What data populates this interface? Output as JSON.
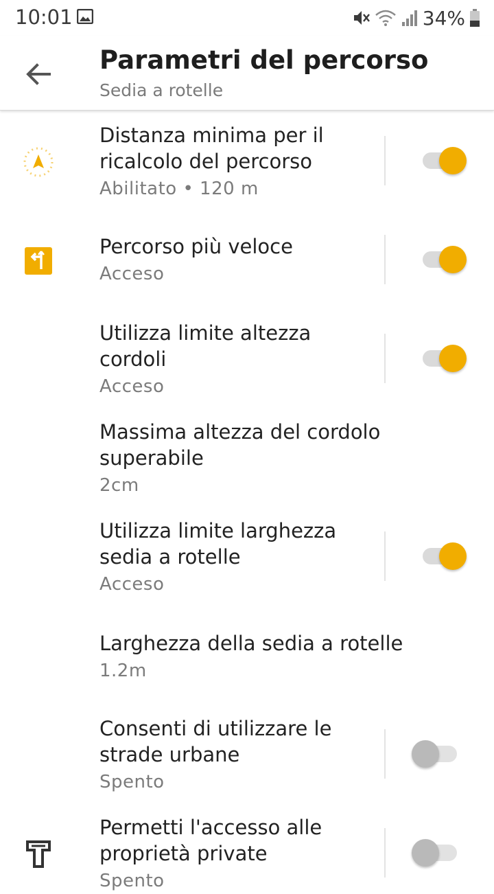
{
  "status_bar": {
    "time": "10:01",
    "battery": "34%"
  },
  "header": {
    "title": "Parametri del percorso",
    "subtitle": "Sedia a rotelle"
  },
  "colors": {
    "accent": "#f1ad00",
    "switch_off": "#b9b9b9"
  },
  "settings": [
    {
      "title": "Distanza minima per il ricalcolo del percorso",
      "summary": "Abilitato • 120 m",
      "toggle": true,
      "icon": "navigation-arrow-icon"
    },
    {
      "title": "Percorso più veloce",
      "summary": "Acceso",
      "toggle": true,
      "icon": "fastest-route-icon"
    },
    {
      "title": "Utilizza limite altezza cordoli",
      "summary": "Acceso",
      "toggle": true
    },
    {
      "title": "Massima altezza del cordolo superabile",
      "summary": "2cm"
    },
    {
      "title": "Utilizza limite larghezza sedia a rotelle",
      "summary": "Acceso",
      "toggle": true
    },
    {
      "title": "Larghezza della sedia a rotelle",
      "summary": "1.2m"
    },
    {
      "title": "Consenti di utilizzare le strade urbane",
      "summary": "Spento",
      "toggle": false
    },
    {
      "title": "Permetti l'accesso alle proprietà private",
      "summary": "Spento",
      "toggle": false,
      "icon": "private-property-icon"
    }
  ]
}
